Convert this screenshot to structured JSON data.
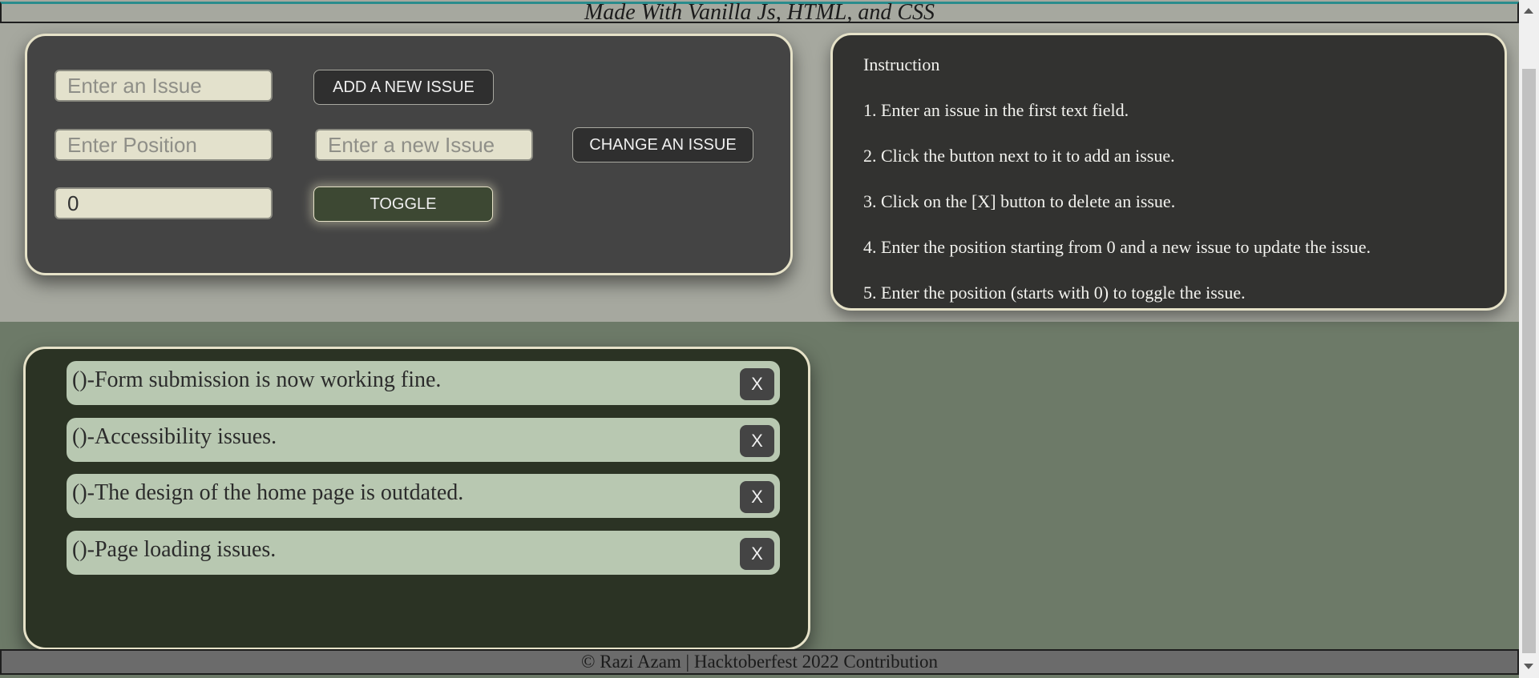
{
  "header": {
    "text": "Made With Vanilla Js, HTML, and CSS"
  },
  "controls": {
    "issue_input_placeholder": "Enter an Issue",
    "add_button": "ADD A NEW ISSUE",
    "position_input_placeholder": "Enter Position",
    "new_issue_input_placeholder": "Enter a new Issue",
    "change_button": "CHANGE AN ISSUE",
    "toggle_input_value": "0",
    "toggle_button": "TOGGLE"
  },
  "instructions": {
    "title": "Instruction",
    "steps": [
      "1. Enter an issue in the first text field.",
      "2. Click the button next to it to add an issue.",
      "3. Click on the [X] button to delete an issue.",
      "4. Enter the position starting from 0 and a new issue to update the issue.",
      "5. Enter the position (starts with 0) to toggle the issue."
    ]
  },
  "issues": [
    {
      "text": "()-Form submission is now working fine.",
      "delete_label": "X"
    },
    {
      "text": "()-Accessibility issues.",
      "delete_label": "X"
    },
    {
      "text": "()-The design of the home page is outdated.",
      "delete_label": "X"
    },
    {
      "text": "()-Page loading issues.",
      "delete_label": "X"
    }
  ],
  "footer": {
    "text": "© Razi Azam | Hacktoberfest 2022 Contribution"
  },
  "colors": {
    "page_top": "#a6a89f",
    "page_bottom": "#6d7a68",
    "control_card": "#444444",
    "instruction_card": "#323230",
    "issues_card": "#2b3324",
    "issue_item": "#b8c8b1",
    "card_border": "#e6e2c8"
  }
}
